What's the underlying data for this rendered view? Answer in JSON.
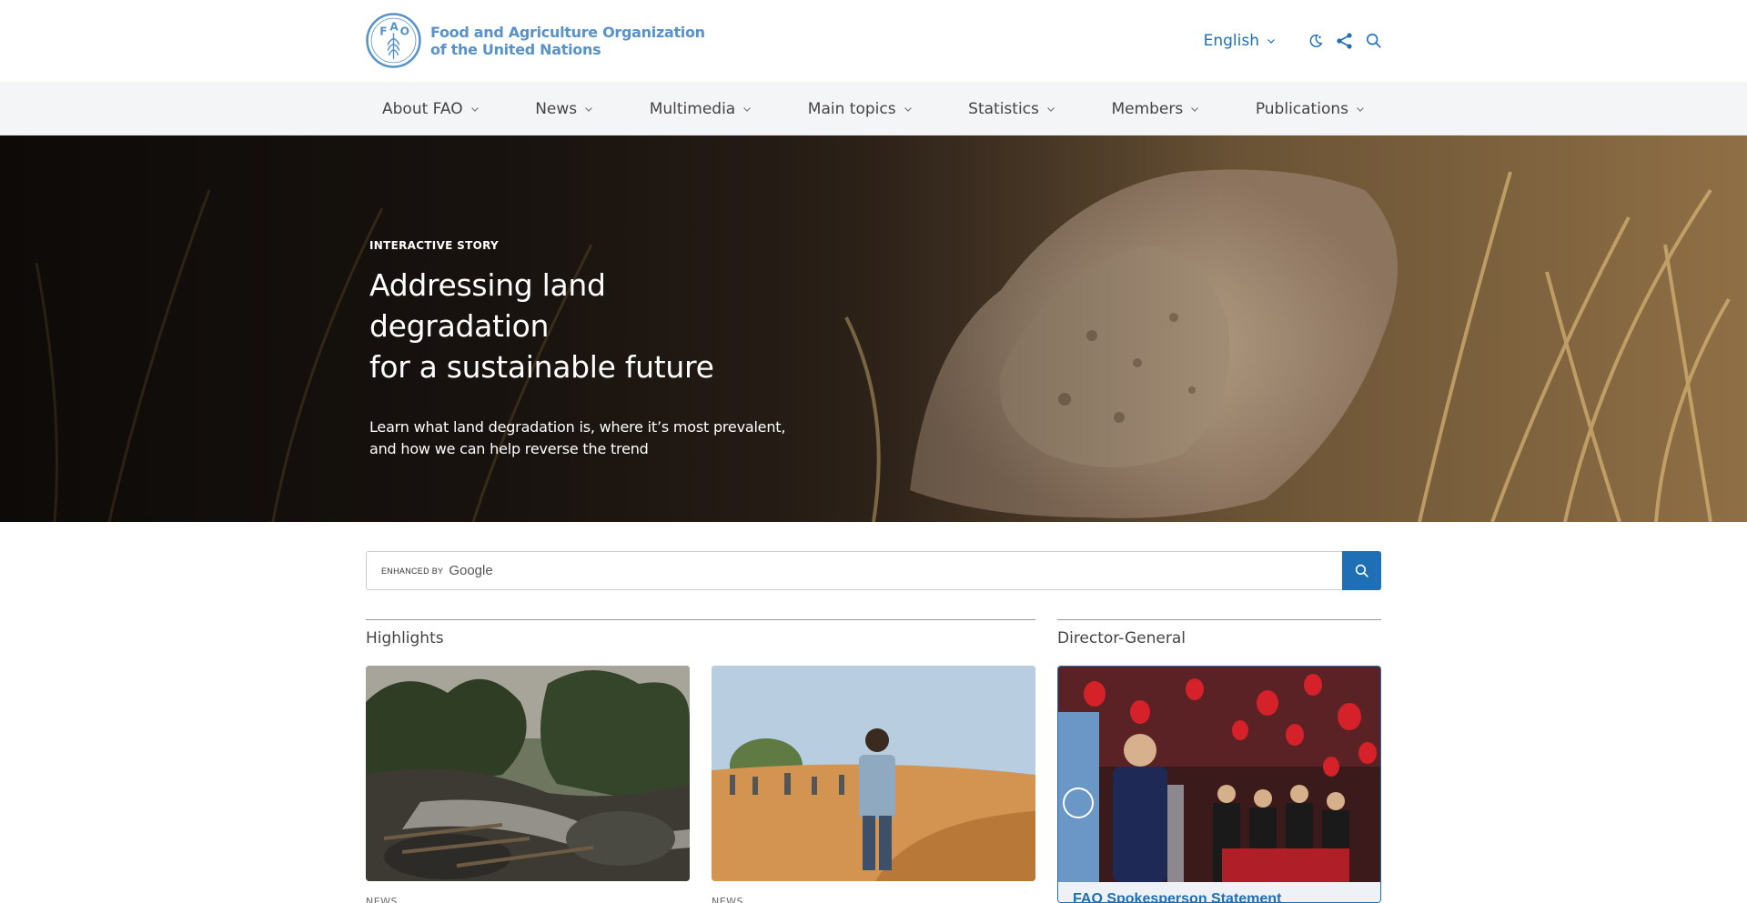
{
  "header": {
    "org_name_line1": "Food and Agriculture Organization",
    "org_name_line2": "of the United Nations",
    "emblem_letters": "F A O",
    "emblem_motto": "FIAT PANIS",
    "language": "English",
    "icons": [
      "dark-mode-icon",
      "share-icon",
      "search-icon"
    ]
  },
  "nav": {
    "items": [
      {
        "label": "About FAO"
      },
      {
        "label": "News"
      },
      {
        "label": "Multimedia"
      },
      {
        "label": "Main topics"
      },
      {
        "label": "Statistics"
      },
      {
        "label": "Members"
      },
      {
        "label": "Publications"
      }
    ]
  },
  "hero": {
    "eyebrow": "INTERACTIVE STORY",
    "title_line1": "Addressing land degradation",
    "title_line2": "for a sustainable future",
    "desc_line1": "Learn what land degradation is, where it’s most prevalent,",
    "desc_line2": "and how we can help reverse the trend"
  },
  "search": {
    "enhanced_by": "ENHANCED BY",
    "brand": "Google",
    "placeholder": ""
  },
  "sections": {
    "highlights": "Highlights",
    "director_general": "Director-General"
  },
  "cards": [
    {
      "label": "NEWS"
    },
    {
      "label": "NEWS"
    }
  ],
  "dg_card": {
    "caption": "FAO Spokesperson Statement"
  },
  "colors": {
    "brand_blue": "#5792c9",
    "link_blue": "#1d6fb8",
    "button_blue": "#1f6fb5",
    "nav_bg": "#f4f5f6"
  }
}
